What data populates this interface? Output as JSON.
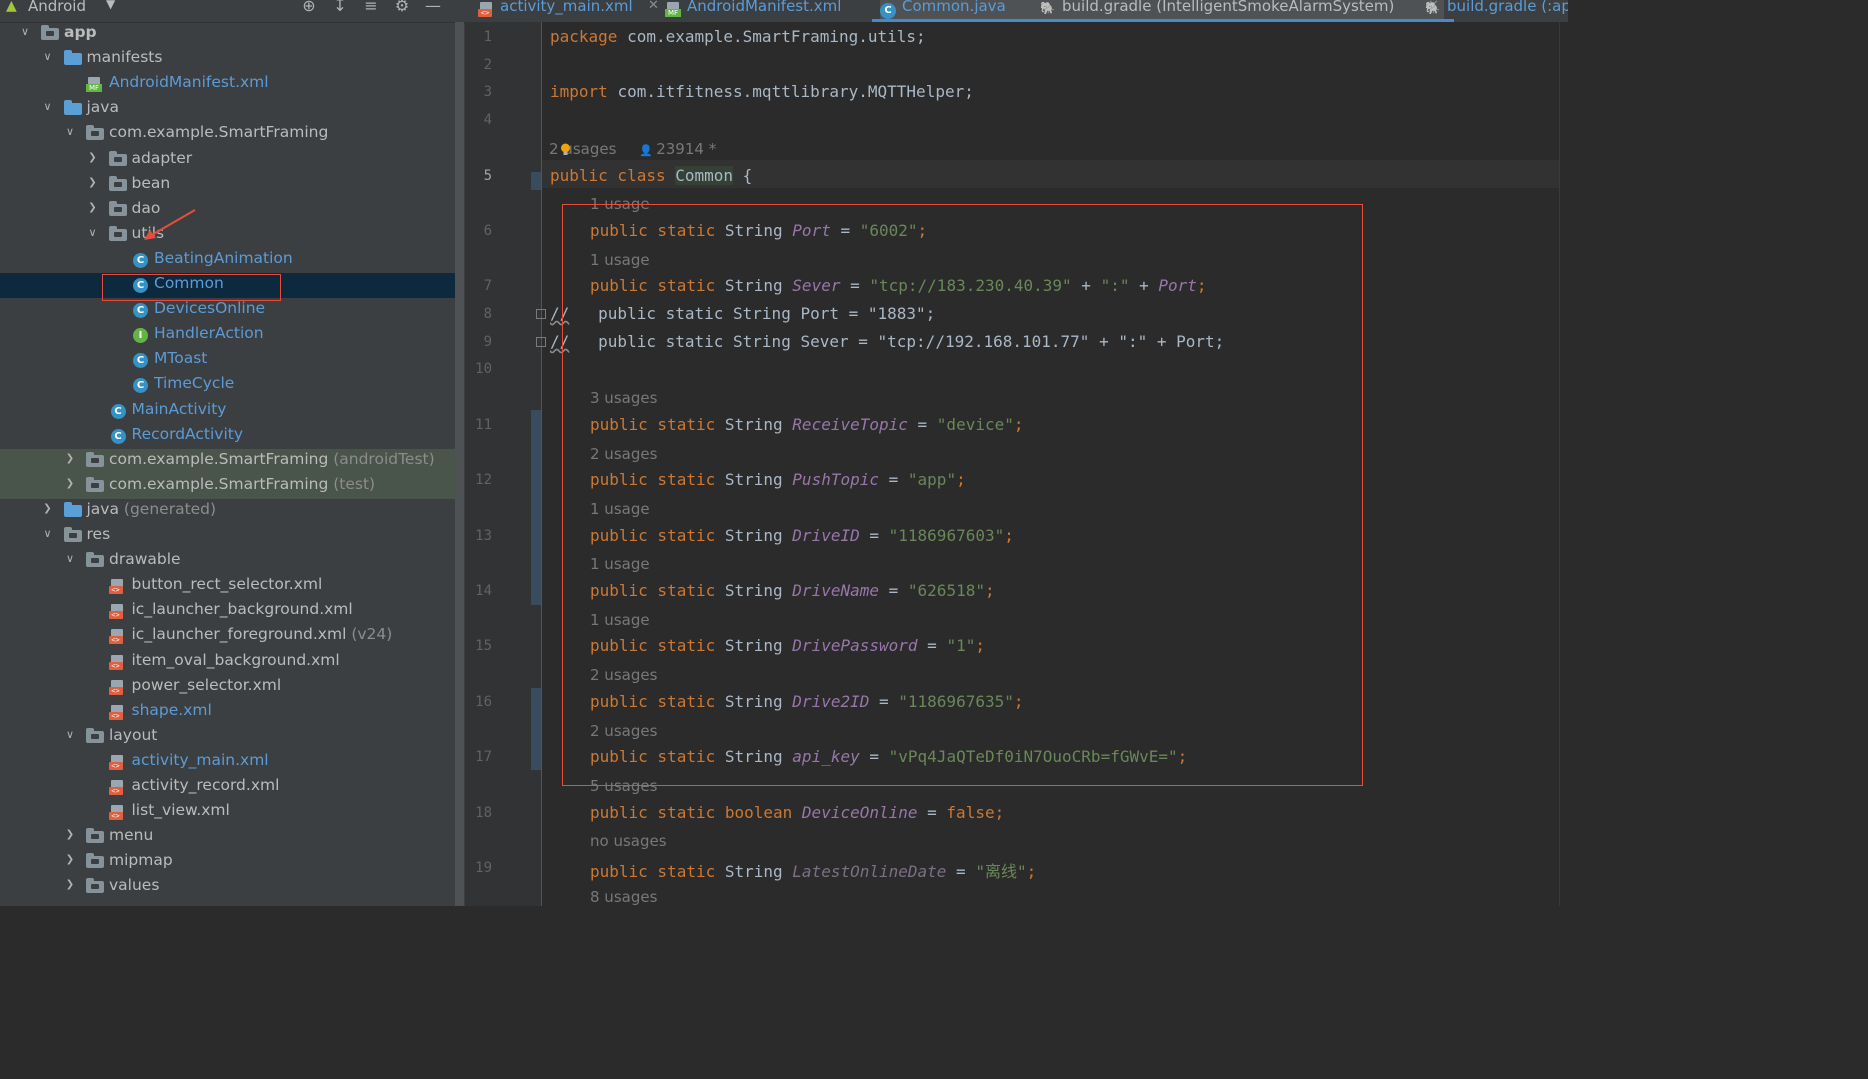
{
  "project_panel": {
    "view_selector": "Android",
    "tool_icons": [
      "locate-icon",
      "expand-all-icon",
      "collapse-all-icon",
      "gear-icon",
      "hide-icon"
    ],
    "tree": [
      {
        "label": "app",
        "suffix": "",
        "depth": 0,
        "chevron": "open",
        "icon": "module",
        "style": "bold",
        "state": ""
      },
      {
        "label": "manifests",
        "suffix": "",
        "depth": 1,
        "chevron": "open",
        "icon": "folder-blue",
        "style": "",
        "state": ""
      },
      {
        "label": "AndroidManifest.xml",
        "suffix": "",
        "depth": 2,
        "chevron": "",
        "icon": "manifest",
        "style": "blue",
        "state": ""
      },
      {
        "label": "java",
        "suffix": "",
        "depth": 1,
        "chevron": "open",
        "icon": "folder-blue",
        "style": "",
        "state": ""
      },
      {
        "label": "com.example.SmartFraming",
        "suffix": "",
        "depth": 2,
        "chevron": "open",
        "icon": "package",
        "style": "",
        "state": ""
      },
      {
        "label": "adapter",
        "suffix": "",
        "depth": 3,
        "chevron": "closed",
        "icon": "package",
        "style": "",
        "state": ""
      },
      {
        "label": "bean",
        "suffix": "",
        "depth": 3,
        "chevron": "closed",
        "icon": "package",
        "style": "",
        "state": ""
      },
      {
        "label": "dao",
        "suffix": "",
        "depth": 3,
        "chevron": "closed",
        "icon": "package",
        "style": "",
        "state": ""
      },
      {
        "label": "utils",
        "suffix": "",
        "depth": 3,
        "chevron": "open",
        "icon": "package",
        "style": "",
        "state": ""
      },
      {
        "label": "BeatingAnimation",
        "suffix": "",
        "depth": 4,
        "chevron": "",
        "icon": "class",
        "style": "blue",
        "state": ""
      },
      {
        "label": "Common",
        "suffix": "",
        "depth": 4,
        "chevron": "",
        "icon": "class",
        "style": "blue",
        "state": "selected"
      },
      {
        "label": "DevicesOnline",
        "suffix": "",
        "depth": 4,
        "chevron": "",
        "icon": "class",
        "style": "blue",
        "state": ""
      },
      {
        "label": "HandlerAction",
        "suffix": "",
        "depth": 4,
        "chevron": "",
        "icon": "interface",
        "style": "blue",
        "state": ""
      },
      {
        "label": "MToast",
        "suffix": "",
        "depth": 4,
        "chevron": "",
        "icon": "class",
        "style": "blue",
        "state": ""
      },
      {
        "label": "TimeCycle",
        "suffix": "",
        "depth": 4,
        "chevron": "",
        "icon": "class",
        "style": "blue",
        "state": ""
      },
      {
        "label": "MainActivity",
        "suffix": "",
        "depth": 3,
        "chevron": "",
        "icon": "class",
        "style": "blue",
        "state": ""
      },
      {
        "label": "RecordActivity",
        "suffix": "",
        "depth": 3,
        "chevron": "",
        "icon": "class",
        "style": "blue",
        "state": ""
      },
      {
        "label": "com.example.SmartFraming",
        "suffix": " (androidTest)",
        "depth": 2,
        "chevron": "closed",
        "icon": "package",
        "style": "",
        "state": "testpkg"
      },
      {
        "label": "com.example.SmartFraming",
        "suffix": " (test)",
        "depth": 2,
        "chevron": "closed",
        "icon": "package",
        "style": "",
        "state": "testpkg"
      },
      {
        "label": "java",
        "suffix": " (generated)",
        "depth": 1,
        "chevron": "closed",
        "icon": "folder-blue",
        "style": "",
        "state": ""
      },
      {
        "label": "res",
        "suffix": "",
        "depth": 1,
        "chevron": "open",
        "icon": "res-folder",
        "style": "",
        "state": ""
      },
      {
        "label": "drawable",
        "suffix": "",
        "depth": 2,
        "chevron": "open",
        "icon": "package",
        "style": "",
        "state": ""
      },
      {
        "label": "button_rect_selector.xml",
        "suffix": "",
        "depth": 3,
        "chevron": "",
        "icon": "xml",
        "style": "",
        "state": ""
      },
      {
        "label": "ic_launcher_background.xml",
        "suffix": "",
        "depth": 3,
        "chevron": "",
        "icon": "xml",
        "style": "",
        "state": ""
      },
      {
        "label": "ic_launcher_foreground.xml",
        "suffix": " (v24)",
        "depth": 3,
        "chevron": "",
        "icon": "xml",
        "style": "",
        "state": ""
      },
      {
        "label": "item_oval_background.xml",
        "suffix": "",
        "depth": 3,
        "chevron": "",
        "icon": "xml",
        "style": "",
        "state": ""
      },
      {
        "label": "power_selector.xml",
        "suffix": "",
        "depth": 3,
        "chevron": "",
        "icon": "xml",
        "style": "",
        "state": ""
      },
      {
        "label": "shape.xml",
        "suffix": "",
        "depth": 3,
        "chevron": "",
        "icon": "xml",
        "style": "blue",
        "state": ""
      },
      {
        "label": "layout",
        "suffix": "",
        "depth": 2,
        "chevron": "open",
        "icon": "package",
        "style": "",
        "state": ""
      },
      {
        "label": "activity_main.xml",
        "suffix": "",
        "depth": 3,
        "chevron": "",
        "icon": "xml",
        "style": "blue",
        "state": ""
      },
      {
        "label": "activity_record.xml",
        "suffix": "",
        "depth": 3,
        "chevron": "",
        "icon": "xml",
        "style": "",
        "state": ""
      },
      {
        "label": "list_view.xml",
        "suffix": "",
        "depth": 3,
        "chevron": "",
        "icon": "xml",
        "style": "",
        "state": ""
      },
      {
        "label": "menu",
        "suffix": "",
        "depth": 2,
        "chevron": "closed",
        "icon": "package",
        "style": "",
        "state": ""
      },
      {
        "label": "mipmap",
        "suffix": "",
        "depth": 2,
        "chevron": "closed",
        "icon": "package",
        "style": "",
        "state": ""
      },
      {
        "label": "values",
        "suffix": "",
        "depth": 2,
        "chevron": "closed",
        "icon": "package",
        "style": "",
        "state": ""
      }
    ]
  },
  "tabs": [
    {
      "label": "activity_main.xml",
      "icon": "xml",
      "active": false,
      "color": "blue"
    },
    {
      "label": "AndroidManifest.xml",
      "icon": "manifest",
      "active": false,
      "color": "blue"
    },
    {
      "label": "Common.java",
      "icon": "class",
      "active": true,
      "color": "blue"
    },
    {
      "label": "build.gradle (IntelligentSmokeAlarmSystem)",
      "icon": "gradle",
      "active": false,
      "color": "normal"
    },
    {
      "label": "build.gradle (:ap",
      "icon": "gradle",
      "active": false,
      "color": "blue"
    }
  ],
  "editor": {
    "current_line": 5,
    "lines": [
      {
        "kind": "code",
        "num": "1",
        "tokens": [
          [
            "kw",
            "package "
          ],
          [
            "",
            "com.example.SmartFraming.utils;"
          ]
        ]
      },
      {
        "kind": "code",
        "num": "2",
        "tokens": []
      },
      {
        "kind": "code",
        "num": "3",
        "tokens": [
          [
            "kw",
            "import "
          ],
          [
            "",
            "com.itfitness.mqttlibrary.MQTTHelper;"
          ]
        ]
      },
      {
        "kind": "code",
        "num": "4",
        "tokens": []
      },
      {
        "kind": "meta",
        "usages": "2 usages",
        "author": "23914 *"
      },
      {
        "kind": "code",
        "num": "5",
        "tokens": [
          [
            "kw",
            "public class "
          ],
          [
            "cls",
            "Common"
          ],
          [
            "",
            " {"
          ]
        ]
      },
      {
        "kind": "hint",
        "text": "1 usage"
      },
      {
        "kind": "code",
        "num": "6",
        "indent": true,
        "tokens": [
          [
            "kw",
            "public static "
          ],
          [
            "",
            "String "
          ],
          [
            "fld",
            "Port"
          ],
          [
            "",
            " = "
          ],
          [
            "str",
            "\"6002\""
          ],
          [
            "kw",
            ";"
          ]
        ]
      },
      {
        "kind": "hint",
        "text": "1 usage"
      },
      {
        "kind": "code",
        "num": "7",
        "indent": true,
        "tokens": [
          [
            "kw",
            "public static "
          ],
          [
            "",
            "String "
          ],
          [
            "fld",
            "Sever"
          ],
          [
            "",
            " = "
          ],
          [
            "str",
            "\"tcp://183.230.40.39\""
          ],
          [
            "",
            " + "
          ],
          [
            "str",
            "\":\""
          ],
          [
            "",
            " + "
          ],
          [
            "fld",
            "Port"
          ],
          [
            "kw",
            ";"
          ]
        ]
      },
      {
        "kind": "code",
        "num": "8",
        "comment": true,
        "tokens": [
          [
            "",
            "//"
          ],
          [
            "",
            "   public static String Port = \"1883\";"
          ]
        ]
      },
      {
        "kind": "code",
        "num": "9",
        "comment": true,
        "tokens": [
          [
            "",
            "//"
          ],
          [
            "",
            "   public static String Sever = \"tcp://192.168.101.77\" + \":\" + Port;"
          ]
        ]
      },
      {
        "kind": "code",
        "num": "10",
        "tokens": []
      },
      {
        "kind": "hint",
        "text": "3 usages"
      },
      {
        "kind": "code",
        "num": "11",
        "indent": true,
        "tokens": [
          [
            "kw",
            "public static "
          ],
          [
            "",
            "String "
          ],
          [
            "fld",
            "ReceiveTopic"
          ],
          [
            "",
            " = "
          ],
          [
            "str",
            "\"device\""
          ],
          [
            "kw",
            ";"
          ]
        ]
      },
      {
        "kind": "hint",
        "text": "2 usages"
      },
      {
        "kind": "code",
        "num": "12",
        "indent": true,
        "tokens": [
          [
            "kw",
            "public static "
          ],
          [
            "",
            "String "
          ],
          [
            "fld",
            "PushTopic"
          ],
          [
            "",
            " = "
          ],
          [
            "str",
            "\"app\""
          ],
          [
            "kw",
            ";"
          ]
        ]
      },
      {
        "kind": "hint",
        "text": "1 usage"
      },
      {
        "kind": "code",
        "num": "13",
        "indent": true,
        "tokens": [
          [
            "kw",
            "public static "
          ],
          [
            "",
            "String "
          ],
          [
            "fld",
            "DriveID"
          ],
          [
            "",
            " = "
          ],
          [
            "str",
            "\"1186967603\""
          ],
          [
            "kw",
            ";"
          ]
        ]
      },
      {
        "kind": "hint",
        "text": "1 usage"
      },
      {
        "kind": "code",
        "num": "14",
        "indent": true,
        "tokens": [
          [
            "kw",
            "public static "
          ],
          [
            "",
            "String "
          ],
          [
            "fld",
            "DriveName"
          ],
          [
            "",
            " = "
          ],
          [
            "str",
            "\"626518\""
          ],
          [
            "kw",
            ";"
          ]
        ]
      },
      {
        "kind": "hint",
        "text": "1 usage"
      },
      {
        "kind": "code",
        "num": "15",
        "indent": true,
        "tokens": [
          [
            "kw",
            "public static "
          ],
          [
            "",
            "String "
          ],
          [
            "fld",
            "DrivePassword"
          ],
          [
            "",
            " = "
          ],
          [
            "str",
            "\"1\""
          ],
          [
            "kw",
            ";"
          ]
        ]
      },
      {
        "kind": "hint",
        "text": "2 usages"
      },
      {
        "kind": "code",
        "num": "16",
        "indent": true,
        "tokens": [
          [
            "kw",
            "public static "
          ],
          [
            "",
            "String "
          ],
          [
            "fld",
            "Drive2ID"
          ],
          [
            "",
            " = "
          ],
          [
            "str",
            "\"1186967635\""
          ],
          [
            "kw",
            ";"
          ]
        ]
      },
      {
        "kind": "hint",
        "text": "2 usages"
      },
      {
        "kind": "code",
        "num": "17",
        "indent": true,
        "tokens": [
          [
            "kw",
            "public static "
          ],
          [
            "",
            "String "
          ],
          [
            "fld",
            "api_key"
          ],
          [
            "",
            " = "
          ],
          [
            "str",
            "\"vPq4JaQTeDf0iN7OuoCRb=fGWvE=\""
          ],
          [
            "kw",
            ";"
          ]
        ]
      },
      {
        "kind": "hint",
        "text": "5 usages"
      },
      {
        "kind": "code",
        "num": "18",
        "indent": true,
        "tokens": [
          [
            "kw",
            "public static boolean "
          ],
          [
            "fld",
            "DeviceOnline"
          ],
          [
            "",
            " = "
          ],
          [
            "kw",
            "false;"
          ]
        ]
      },
      {
        "kind": "hint",
        "text": "no usages"
      },
      {
        "kind": "code",
        "num": "19",
        "indent": true,
        "tokens": [
          [
            "kw",
            "public static "
          ],
          [
            "",
            "String "
          ],
          [
            "fldu",
            "LatestOnlineDate"
          ],
          [
            "",
            " = "
          ],
          [
            "str",
            "\"离线\""
          ],
          [
            "kw",
            ";"
          ]
        ]
      },
      {
        "kind": "hint",
        "text": "8 usages"
      }
    ]
  },
  "colors": {
    "annotation": "#e74c3c",
    "keyword": "#cc7832",
    "string": "#6a8759",
    "field": "#9876aa",
    "selection": "#0d293e"
  }
}
